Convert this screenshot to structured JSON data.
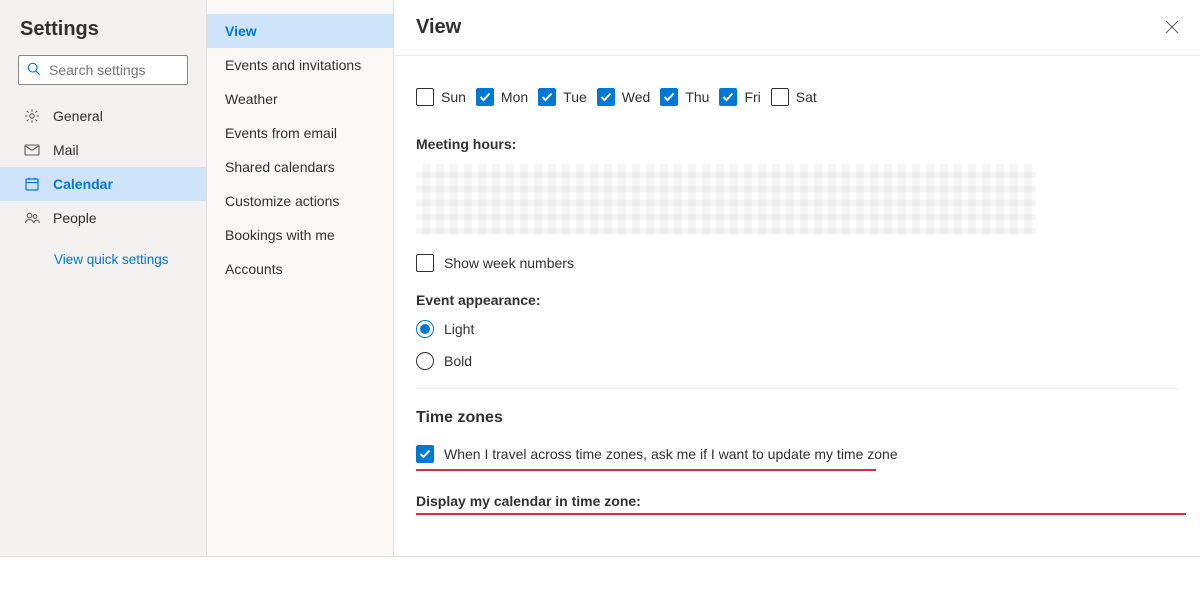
{
  "header": {
    "title": "Settings"
  },
  "search": {
    "placeholder": "Search settings"
  },
  "nav": {
    "items": [
      {
        "label": "General"
      },
      {
        "label": "Mail"
      },
      {
        "label": "Calendar"
      },
      {
        "label": "People"
      }
    ],
    "quick_link": "View quick settings"
  },
  "subnav": {
    "items": [
      {
        "label": "View"
      },
      {
        "label": "Events and invitations"
      },
      {
        "label": "Weather"
      },
      {
        "label": "Events from email"
      },
      {
        "label": "Shared calendars"
      },
      {
        "label": "Customize actions"
      },
      {
        "label": "Bookings with me"
      },
      {
        "label": "Accounts"
      }
    ]
  },
  "main": {
    "title": "View",
    "days": {
      "sun": "Sun",
      "mon": "Mon",
      "tue": "Tue",
      "wed": "Wed",
      "thu": "Thu",
      "fri": "Fri",
      "sat": "Sat"
    },
    "meeting_hours_label": "Meeting hours:",
    "show_week_numbers": "Show week numbers",
    "event_appearance_label": "Event appearance:",
    "appearance": {
      "light": "Light",
      "bold": "Bold"
    },
    "timezones": {
      "title": "Time zones",
      "ask_label": "When I travel across time zones, ask me if I want to update my time zone",
      "display_label": "Display my calendar in time zone:"
    }
  }
}
